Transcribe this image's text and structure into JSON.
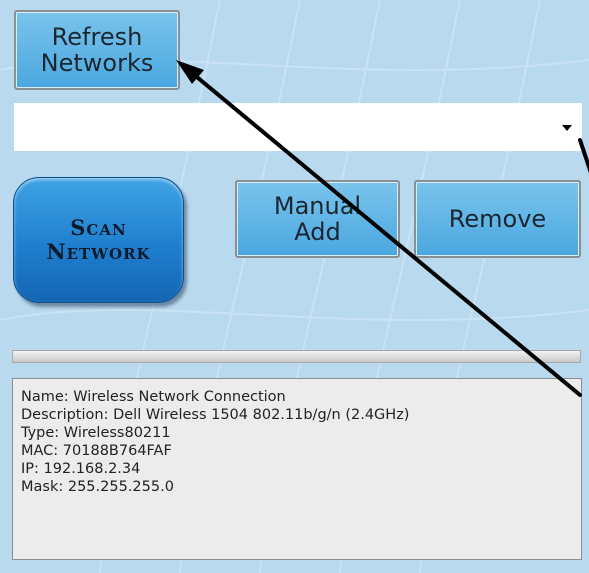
{
  "buttons": {
    "refresh_label": "Refresh\nNetworks",
    "scan_label": "Scan\nNetwork",
    "manual_add_label": "Manual\nAdd",
    "remove_label": "Remove"
  },
  "network_dropdown": {
    "selected": ""
  },
  "progress": {
    "value": 0
  },
  "connection_info": {
    "lines": [
      "Name: Wireless Network Connection",
      "Description: Dell Wireless 1504 802.11b/g/n (2.4GHz)",
      "Type: Wireless80211",
      "MAC: 70188B764FAF",
      "IP: 192.168.2.34",
      "Mask: 255.255.255.0"
    ]
  },
  "icons": {
    "dropdown_caret": "chevron-down-icon",
    "callout_arrows": "arrow-icon"
  },
  "colors": {
    "background": "#b9d9ef",
    "button": "#5ab4e6",
    "scan_button": "#1f7fce",
    "arrow": "#000000"
  }
}
